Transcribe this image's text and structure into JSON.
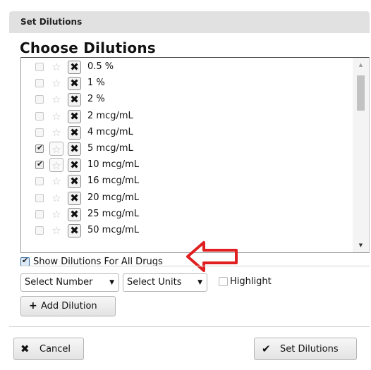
{
  "dialog": {
    "title": "Set Dilutions",
    "heading": "Choose Dilutions"
  },
  "dilutions": [
    {
      "label": "0.5 %",
      "checked": false,
      "starred": false
    },
    {
      "label": "1 %",
      "checked": false,
      "starred": false
    },
    {
      "label": "2 %",
      "checked": false,
      "starred": false
    },
    {
      "label": "2 mcg/mL",
      "checked": false,
      "starred": false
    },
    {
      "label": "4 mcg/mL",
      "checked": false,
      "starred": false
    },
    {
      "label": "5 mcg/mL",
      "checked": true,
      "starred": false
    },
    {
      "label": "10 mcg/mL",
      "checked": true,
      "starred": false
    },
    {
      "label": "16 mcg/mL",
      "checked": false,
      "starred": false
    },
    {
      "label": "20 mcg/mL",
      "checked": false,
      "starred": false
    },
    {
      "label": "25 mcg/mL",
      "checked": false,
      "starred": false
    },
    {
      "label": "50 mcg/mL",
      "checked": false,
      "starred": false
    }
  ],
  "icons": {
    "star": "star-icon",
    "remove": "x-icon",
    "scroll_up": "triangle-up-icon",
    "scroll_down": "triangle-down-icon",
    "annotation": "red-arrow-icon"
  },
  "show_all": {
    "label": "Show Dilutions For All Drugs",
    "checked": true
  },
  "add_form": {
    "number_select": "Select Number",
    "units_select": "Select Units",
    "highlight_label": "Highlight",
    "highlight_checked": false,
    "add_button": "Add Dilution"
  },
  "footer": {
    "cancel_button": "Cancel",
    "set_button": "Set Dilutions"
  },
  "colors": {
    "titlebar": "#e1e1e1",
    "annotation_arrow": "#e02020"
  }
}
